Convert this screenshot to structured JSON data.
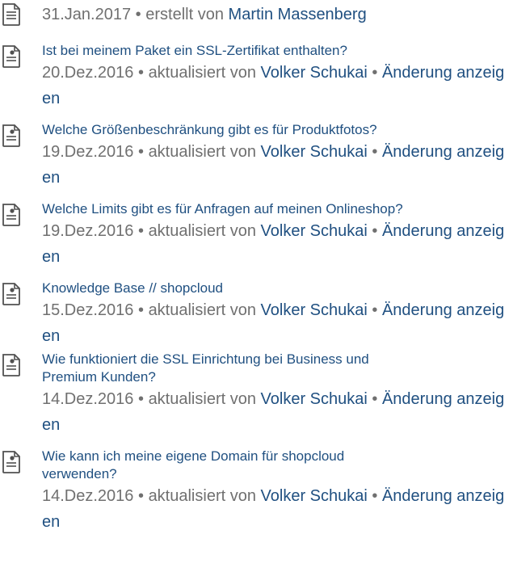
{
  "first_entry": {
    "icon": "page-icon",
    "date": "31.Jan.2017",
    "separator": "•",
    "action": "erstellt von",
    "author": "Martin Massenberg"
  },
  "entries": [
    {
      "icon": "page-updated-icon",
      "title_lines": [
        "Ist bei meinem Paket ein SSL-Zertifikat enthalten?"
      ],
      "date": "20.Dez.2016",
      "separator": "•",
      "action": "aktualisiert von",
      "author": "Volker Schukai",
      "change_link": "Änderung anzeigen"
    },
    {
      "icon": "page-updated-icon",
      "title_lines": [
        "Welche Größenbeschränkung gibt es für Produktfotos?"
      ],
      "date": "19.Dez.2016",
      "separator": "•",
      "action": "aktualisiert von",
      "author": "Volker Schukai",
      "change_link": "Änderung anzeigen"
    },
    {
      "icon": "page-updated-icon",
      "title_lines": [
        "Welche Limits gibt es für Anfragen auf meinen Onlineshop?"
      ],
      "date": "19.Dez.2016",
      "separator": "•",
      "action": "aktualisiert von",
      "author": "Volker Schukai",
      "change_link": "Änderung anzeigen"
    },
    {
      "icon": "page-updated-icon",
      "title_lines": [
        "Knowledge Base // shopcloud"
      ],
      "date": "15.Dez.2016",
      "separator": "•",
      "action": "aktualisiert von",
      "author": "Volker Schukai",
      "change_link": "Änderung anzeigen"
    },
    {
      "icon": "page-updated-icon",
      "title_lines": [
        "Wie funktioniert die SSL Einrichtung bei Business und",
        "Premium Kunden?"
      ],
      "date": "14.Dez.2016",
      "separator": "•",
      "action": "aktualisiert von",
      "author": "Volker Schukai",
      "change_link": "Änderung anzeigen"
    },
    {
      "icon": "page-updated-icon",
      "title_lines": [
        "Wie kann ich meine eigene Domain für shopcloud",
        "verwenden?"
      ],
      "date": "14.Dez.2016",
      "separator": "•",
      "action": "aktualisiert von",
      "author": "Volker Schukai",
      "change_link": "Änderung anzeigen"
    }
  ],
  "colors": {
    "link": "#205081",
    "meta_text": "#707070",
    "icon_stroke": "#505050"
  }
}
